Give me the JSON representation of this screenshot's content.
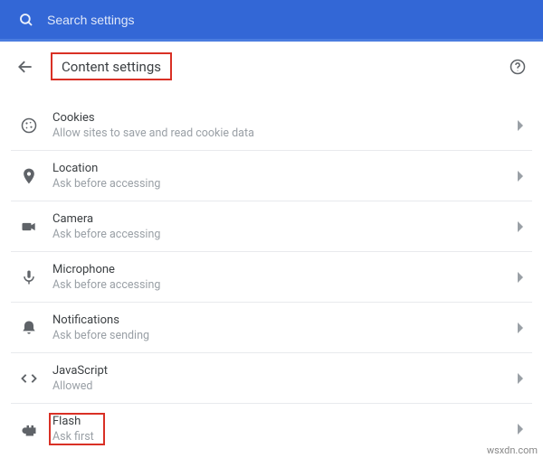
{
  "search": {
    "placeholder": "Search settings"
  },
  "header": {
    "title": "Content settings"
  },
  "rows": {
    "cookies": {
      "title": "Cookies",
      "sub": "Allow sites to save and read cookie data"
    },
    "location": {
      "title": "Location",
      "sub": "Ask before accessing"
    },
    "camera": {
      "title": "Camera",
      "sub": "Ask before accessing"
    },
    "microphone": {
      "title": "Microphone",
      "sub": "Ask before accessing"
    },
    "notifications": {
      "title": "Notifications",
      "sub": "Ask before sending"
    },
    "javascript": {
      "title": "JavaScript",
      "sub": "Allowed"
    },
    "flash": {
      "title": "Flash",
      "sub": "Ask first"
    }
  },
  "watermark": "wsxdn.com"
}
